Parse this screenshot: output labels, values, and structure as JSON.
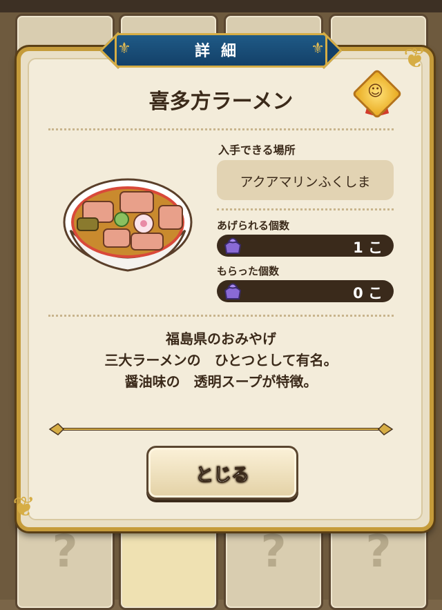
{
  "dialog": {
    "header": "詳細",
    "item_name": "喜多方ラーメン",
    "location_label": "入手できる場所",
    "location_value": "アクアマリンふくしま",
    "giveable_label": "あげられる個数",
    "giveable_value": "1 こ",
    "received_label": "もらった個数",
    "received_value": "0 こ",
    "description": [
      "福島県のおみやげ",
      "三大ラーメンの　ひとつとして有名。",
      "醤油味の　透明スープが特徴。"
    ],
    "close_label": "とじる"
  },
  "background": {
    "unknown_mark": "?"
  },
  "icons": {
    "medal": "gold-medal-icon",
    "gift": "purple-gift-icon",
    "bowl": "ramen-bowl-icon"
  },
  "colors": {
    "banner": "#134068",
    "gold": "#d6ad45",
    "panel": "#f3ecda",
    "dark_bar": "#3a2a1b"
  }
}
